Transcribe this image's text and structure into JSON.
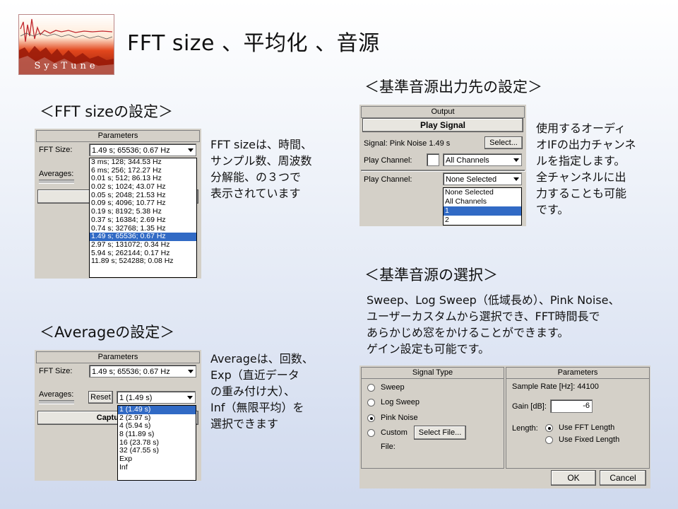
{
  "slide": {
    "title": "FFT size 、平均化 、音源",
    "logo_text": "SysTune"
  },
  "fft": {
    "heading": "＜FFT sizeの設定＞",
    "description": "FFT sizeは、時間、\nサンプル数、周波数\n分解能、の３つで\n表示されています",
    "panel": {
      "title": "Parameters",
      "fft_size_label": "FFT Size:",
      "fft_size_value": "1.49 s; 65536; 0.67 Hz",
      "averages_label": "Averages:",
      "capture_label": "Capt",
      "options": [
        "3 ms; 128; 344.53 Hz",
        "6 ms; 256; 172.27 Hz",
        "0.01 s; 512; 86.13 Hz",
        "0.02 s; 1024; 43.07 Hz",
        "0.05 s; 2048; 21.53 Hz",
        "0.09 s; 4096; 10.77 Hz",
        "0.19 s; 8192; 5.38 Hz",
        "0.37 s; 16384; 2.69 Hz",
        "0.74 s; 32768; 1.35 Hz",
        "1.49 s; 65536; 0.67 Hz",
        "2.97 s; 131072; 0.34 Hz",
        "5.94 s; 262144; 0.17 Hz",
        "11.89 s; 524288; 0.08 Hz"
      ]
    }
  },
  "average": {
    "heading": "＜Averageの設定＞",
    "description": "Averageは、回数、\nExp（直近データ\nの重み付け大）、\nInf（無限平均）を\n選択できます",
    "panel": {
      "title": "Parameters",
      "fft_size_label": "FFT Size:",
      "fft_size_value": "1.49 s; 65536; 0.67 Hz",
      "averages_label": "Averages:",
      "reset_label": "Reset",
      "average_value": "1 (1.49 s)",
      "capture_label": "Capture Mo",
      "options": [
        "1 (1.49 s)",
        "2 (2.97 s)",
        "4 (5.94 s)",
        "8 (11.89 s)",
        "16 (23.78 s)",
        "32 (47.55 s)",
        "Exp",
        "Inf"
      ]
    }
  },
  "output": {
    "heading": "＜基準音源出力先の設定＞",
    "description": "使用するオーディ\nオIFの出力チャンネ\nルを指定します。\n全チャンネルに出\n力することも可能\nです。",
    "panel": {
      "title": "Output",
      "play_signal_label": "Play Signal",
      "signal_label": "Signal: Pink Noise  1.49 s",
      "select_label": "Select...",
      "play_channel_label_1": "Play Channel:",
      "play_channel_value_1": "All Channels",
      "play_channel_label_2": "Play Channel:",
      "play_channel_value_2": "None Selected",
      "options": [
        "None Selected",
        "All Channels",
        "1",
        "2"
      ]
    }
  },
  "source": {
    "heading": "＜基準音源の選択＞",
    "description": "Sweep、Log Sweep（低域長め）、Pink Noise、\nユーザーカスタムから選択でき、FFT時間長で\nあらかじめ窓をかけることができます。\nゲイン設定も可能です。",
    "signal_type": {
      "title": "Signal Type",
      "options": [
        "Sweep",
        "Log Sweep",
        "Pink Noise",
        "Custom"
      ],
      "selected": "Pink Noise",
      "select_file_label": "Select File...",
      "file_label": "File:"
    },
    "parameters": {
      "title": "Parameters",
      "sample_rate_label": "Sample Rate [Hz]: 44100",
      "gain_label": "Gain [dB]:",
      "gain_value": "-6",
      "length_label": "Length:",
      "length_options": [
        "Use FFT Length",
        "Use Fixed Length"
      ],
      "length_selected": "Use FFT Length"
    },
    "ok_label": "OK",
    "cancel_label": "Cancel"
  }
}
